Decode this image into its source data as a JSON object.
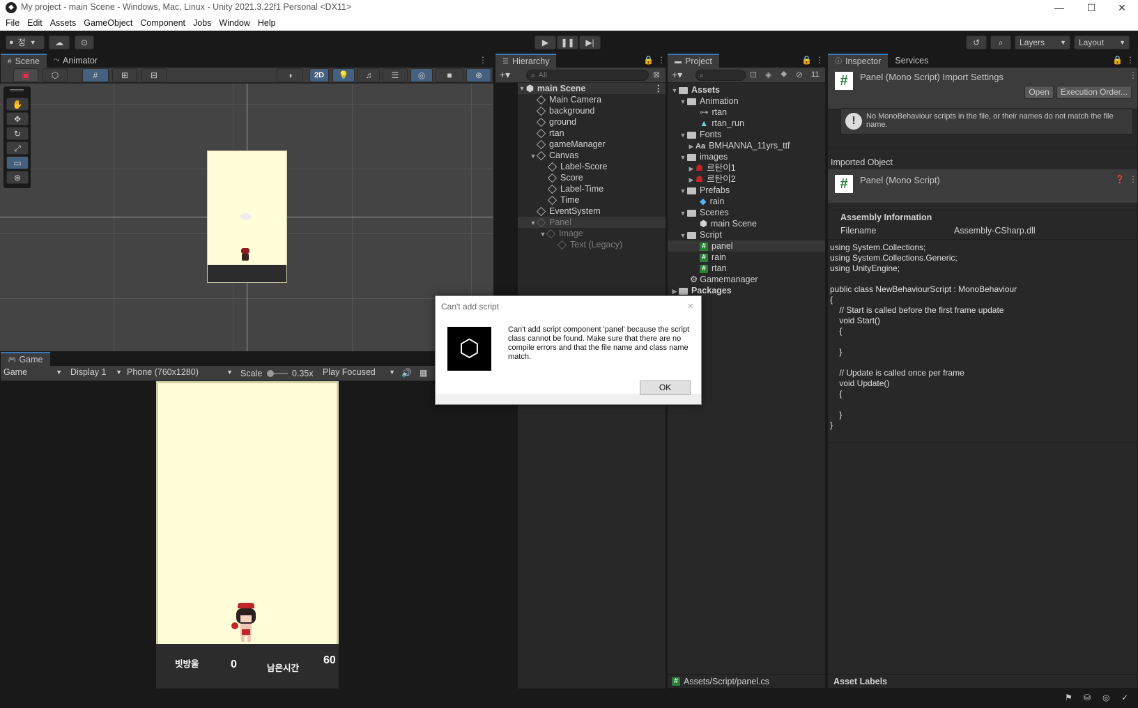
{
  "window": {
    "title": "My project - main Scene - Windows, Mac, Linux - Unity 2021.3.22f1 Personal <DX11>",
    "minimize": "—",
    "maximize": "☐",
    "close": "✕"
  },
  "menu": [
    "File",
    "Edit",
    "Assets",
    "GameObject",
    "Component",
    "Jobs",
    "Window",
    "Help"
  ],
  "toolbar": {
    "account": "정",
    "layers": "Layers",
    "layout": "Layout"
  },
  "scene": {
    "tabs": [
      "Scene",
      "Animator"
    ],
    "mode_2d": "2D"
  },
  "game": {
    "tab": "Game",
    "view_mode": "Game",
    "display": "Display 1",
    "resolution": "Phone (760x1280)",
    "scale_label": "Scale",
    "scale_value": "0.35x",
    "play_mode": "Play Focused",
    "hud": {
      "score_label": "빗방울",
      "score_value": "0",
      "time_label": "남은시간",
      "time_value": "60"
    }
  },
  "hierarchy": {
    "tab": "Hierarchy",
    "search_placeholder": "All",
    "scene_name": "main Scene",
    "items": [
      {
        "label": "Main Camera"
      },
      {
        "label": "background"
      },
      {
        "label": "ground"
      },
      {
        "label": "rtan"
      },
      {
        "label": "gameManager"
      },
      {
        "label": "Canvas"
      },
      {
        "label": "Label-Score"
      },
      {
        "label": "Score"
      },
      {
        "label": "Label-Time"
      },
      {
        "label": "Time"
      },
      {
        "label": "EventSystem"
      },
      {
        "label": "Panel"
      },
      {
        "label": "Image"
      },
      {
        "label": "Text (Legacy)"
      }
    ]
  },
  "project": {
    "tab": "Project",
    "hidden_count": "11",
    "items": [
      {
        "label": "Assets"
      },
      {
        "label": "Animation"
      },
      {
        "label": "rtan"
      },
      {
        "label": "rtan_run"
      },
      {
        "label": "Fonts"
      },
      {
        "label": "BMHANNA_11yrs_ttf"
      },
      {
        "label": "images"
      },
      {
        "label": "르탄이1"
      },
      {
        "label": "르탄이2"
      },
      {
        "label": "Prefabs"
      },
      {
        "label": "rain"
      },
      {
        "label": "Scenes"
      },
      {
        "label": "main Scene"
      },
      {
        "label": "Script"
      },
      {
        "label": "panel"
      },
      {
        "label": "rain"
      },
      {
        "label": "rtan"
      },
      {
        "label": "Gamemanager"
      },
      {
        "label": "Packages"
      }
    ],
    "font_prefix": "Aa",
    "path": "Assets/Script/panel.cs"
  },
  "inspector": {
    "tabs": [
      "Inspector",
      "Services"
    ],
    "header_title": "Panel (Mono Script) Import Settings",
    "open_button": "Open",
    "exec_order_button": "Execution Order...",
    "warning": "No MonoBehaviour scripts in the file, or their names do not match the file name.",
    "imported_object_label": "Imported Object",
    "object_title": "Panel (Mono Script)",
    "assembly_heading": "Assembly Information",
    "filename_label": "Filename",
    "filename_value": "Assembly-CSharp.dll",
    "code": "using System.Collections;\nusing System.Collections.Generic;\nusing UnityEngine;\n\npublic class NewBehaviourScript : MonoBehaviour\n{\n    // Start is called before the first frame update\n    void Start()\n    {\n\n    }\n\n    // Update is called once per frame\n    void Update()\n    {\n\n    }\n}",
    "asset_labels": "Asset Labels"
  },
  "dialog": {
    "title": "Can't add script",
    "message": "Can't add script component 'panel' because the script class cannot be found. Make sure that there are no compile errors and that the file name and class name match.",
    "ok": "OK",
    "close": "✕"
  },
  "colors": {
    "accent": "#3a79bb",
    "script_green": "#2b7f39",
    "scene_bg": "#444444",
    "game_bg": "#fffed9"
  }
}
